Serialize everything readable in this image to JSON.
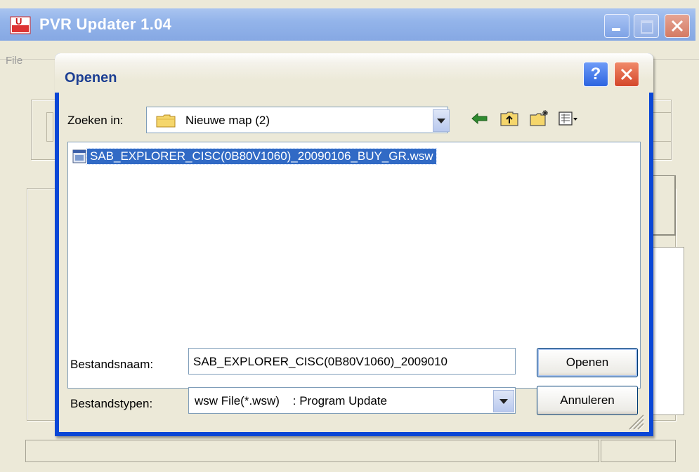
{
  "app": {
    "title": "PVR Updater 1.04",
    "menu": [
      "File"
    ]
  },
  "dialog": {
    "title": "Openen",
    "help_label": "?",
    "look_in": {
      "label": "Zoeken in:",
      "value": "Nieuwe map (2)"
    },
    "toolbar": [
      "back-icon",
      "up-folder-icon",
      "new-folder-icon",
      "view-menu-icon"
    ],
    "files": [
      {
        "name": "SAB_EXPLORER_CISC(0B80V1060)_20090106_BUY_GR.wsw",
        "icon": "wsw-file-icon",
        "selected": true
      }
    ],
    "filename": {
      "label": "Bestandsnaam:",
      "value": "SAB_EXPLORER_CISC(0B80V1060)_2009010"
    },
    "filetype": {
      "label": "Bestandstypen:",
      "value": "wsw File(*.wsw)    : Program Update"
    },
    "open_button": "Openen",
    "cancel_button": "Annuleren"
  },
  "colors": {
    "dialog_frame": "#0a47d6",
    "selection": "#316ac5",
    "face": "#ece9d8"
  }
}
